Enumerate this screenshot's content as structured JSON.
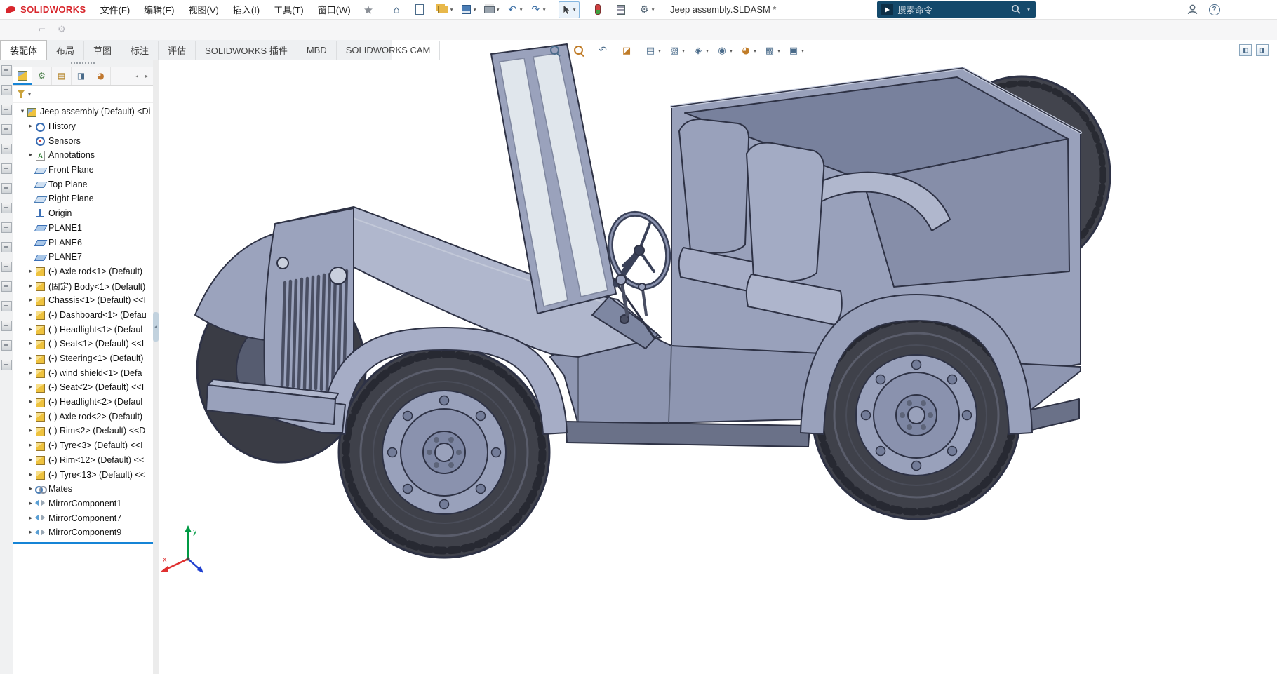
{
  "window": {
    "brand": "SOLIDWORKS",
    "document_title": "Jeep assembly.SLDASM *"
  },
  "menu_bar": {
    "items": [
      {
        "label": "文件(F)"
      },
      {
        "label": "编辑(E)"
      },
      {
        "label": "视图(V)"
      },
      {
        "label": "插入(I)"
      },
      {
        "label": "工具(T)"
      },
      {
        "label": "窗口(W)"
      }
    ]
  },
  "quick_toolbar": {
    "items": [
      {
        "icon": "home-icon",
        "caret": "no-caret"
      },
      {
        "icon": "new-document-icon",
        "caret": "no-caret"
      },
      {
        "icon": "open-icon",
        "caret": "with-caret"
      },
      {
        "icon": "save-icon",
        "caret": "with-caret"
      },
      {
        "icon": "print-icon",
        "caret": "with-caret"
      },
      {
        "icon": "undo-icon",
        "caret": "with-caret"
      },
      {
        "icon": "redo-icon",
        "caret": "with-caret"
      }
    ],
    "right_items": [
      {
        "icon": "rebuild-icon",
        "caret": "no-caret"
      },
      {
        "icon": "task-list-icon",
        "caret": "no-caret"
      },
      {
        "icon": "options-gear-icon",
        "caret": "with-caret"
      }
    ]
  },
  "search": {
    "placeholder": "搜索命令"
  },
  "command_tabs": {
    "items": [
      {
        "label": "装配体",
        "state": "active"
      },
      {
        "label": "布局",
        "state": "idle"
      },
      {
        "label": "草图",
        "state": "idle"
      },
      {
        "label": "标注",
        "state": "idle"
      },
      {
        "label": "评估",
        "state": "idle"
      },
      {
        "label": "SOLIDWORKS 插件",
        "state": "idle"
      },
      {
        "label": "MBD",
        "state": "idle"
      },
      {
        "label": "SOLIDWORKS CAM",
        "state": "idle"
      }
    ]
  },
  "left_toolbar": {
    "items": [
      {
        "name": "left-tool-icon"
      },
      {
        "name": "left-tool-icon"
      },
      {
        "name": "left-tool-icon"
      },
      {
        "name": "left-tool-icon"
      },
      {
        "name": "left-tool-icon"
      },
      {
        "name": "left-tool-icon"
      },
      {
        "name": "left-tool-icon"
      },
      {
        "name": "left-tool-icon"
      },
      {
        "name": "left-tool-icon"
      },
      {
        "name": "left-tool-icon"
      },
      {
        "name": "left-tool-icon"
      },
      {
        "name": "left-tool-icon"
      },
      {
        "name": "left-tool-icon"
      },
      {
        "name": "left-tool-icon"
      },
      {
        "name": "left-tool-icon"
      },
      {
        "name": "left-tool-icon"
      }
    ]
  },
  "tree_panel": {
    "tabs": [
      {
        "icon": "feature-tree-tab-icon",
        "state": "active"
      },
      {
        "icon": "property-manager-tab-icon",
        "state": "idle"
      },
      {
        "icon": "configuration-tab-icon",
        "state": "idle"
      },
      {
        "icon": "dimxpert-tab-icon",
        "state": "idle"
      },
      {
        "icon": "display-manager-tab-icon",
        "state": "idle"
      }
    ],
    "nav": [
      {
        "icon": "tabs-scroll-left-icon"
      },
      {
        "icon": "tabs-scroll-right-icon"
      }
    ],
    "root": {
      "label": "Jeep assembly (Default) <Di",
      "icon": "ic-asm",
      "arrow": "expanded"
    },
    "items": [
      {
        "label": "History",
        "icon": "ic-history",
        "arrow": "expandable"
      },
      {
        "label": "Sensors",
        "icon": "ic-sensors",
        "arrow": "leaf"
      },
      {
        "label": "Annotations",
        "icon": "ic-ann",
        "arrow": "expandable"
      },
      {
        "label": "Front Plane",
        "icon": "ic-plane",
        "arrow": "leaf"
      },
      {
        "label": "Top Plane",
        "icon": "ic-plane",
        "arrow": "leaf"
      },
      {
        "label": "Right Plane",
        "icon": "ic-plane",
        "arrow": "leaf"
      },
      {
        "label": "Origin",
        "icon": "ic-origin",
        "arrow": "leaf"
      },
      {
        "label": "PLANE1",
        "icon": "ic-plane2",
        "arrow": "leaf"
      },
      {
        "label": "PLANE6",
        "icon": "ic-plane2",
        "arrow": "leaf"
      },
      {
        "label": "PLANE7",
        "icon": "ic-plane2",
        "arrow": "leaf"
      },
      {
        "label": "(-) Axle rod<1> (Default)",
        "icon": "ic-part",
        "arrow": "expandable"
      },
      {
        "label": "(固定) Body<1> (Default)",
        "icon": "ic-part",
        "arrow": "expandable"
      },
      {
        "label": "Chassis<1> (Default) <<I",
        "icon": "ic-part",
        "arrow": "expandable"
      },
      {
        "label": "(-) Dashboard<1> (Defau",
        "icon": "ic-part",
        "arrow": "expandable"
      },
      {
        "label": "(-) Headlight<1> (Defaul",
        "icon": "ic-part",
        "arrow": "expandable"
      },
      {
        "label": "(-) Seat<1> (Default) <<I",
        "icon": "ic-part",
        "arrow": "expandable"
      },
      {
        "label": "(-) Steering<1> (Default)",
        "icon": "ic-part",
        "arrow": "expandable"
      },
      {
        "label": "(-) wind shield<1> (Defa",
        "icon": "ic-part",
        "arrow": "expandable"
      },
      {
        "label": "(-) Seat<2> (Default) <<I",
        "icon": "ic-part",
        "arrow": "expandable"
      },
      {
        "label": "(-) Headlight<2> (Defaul",
        "icon": "ic-part",
        "arrow": "expandable"
      },
      {
        "label": "(-) Axle rod<2> (Default)",
        "icon": "ic-part",
        "arrow": "expandable"
      },
      {
        "label": "(-) Rim<2> (Default) <<D",
        "icon": "ic-part",
        "arrow": "expandable"
      },
      {
        "label": "(-) Tyre<3> (Default) <<I",
        "icon": "ic-part",
        "arrow": "expandable"
      },
      {
        "label": "(-) Rim<12> (Default) <<",
        "icon": "ic-part",
        "arrow": "expandable"
      },
      {
        "label": "(-) Tyre<13> (Default) <<",
        "icon": "ic-part",
        "arrow": "expandable"
      },
      {
        "label": "Mates",
        "icon": "ic-mates",
        "arrow": "expandable"
      },
      {
        "label": "MirrorComponent1",
        "icon": "ic-mirror",
        "arrow": "expandable"
      },
      {
        "label": "MirrorComponent7",
        "icon": "ic-mirror",
        "arrow": "expandable"
      },
      {
        "label": "MirrorComponent9",
        "icon": "ic-mirror",
        "arrow": "expandable"
      }
    ]
  },
  "hud": {
    "items": [
      {
        "icon": "zoom-fit-icon",
        "caret": "no-caret"
      },
      {
        "icon": "zoom-area-icon",
        "caret": "no-caret"
      },
      {
        "icon": "previous-view-icon",
        "caret": "no-caret"
      },
      {
        "icon": "section-view-icon",
        "caret": "no-caret"
      },
      {
        "icon": "dynamic-annotation-icon",
        "caret": "with-caret"
      },
      {
        "icon": "view-orientation-icon",
        "caret": "with-caret"
      },
      {
        "icon": "display-style-icon",
        "caret": "with-caret"
      },
      {
        "icon": "hide-show-items-icon",
        "caret": "with-caret"
      },
      {
        "icon": "edit-appearance-icon",
        "caret": "with-caret"
      },
      {
        "icon": "apply-scene-icon",
        "caret": "with-caret"
      },
      {
        "icon": "view-settings-icon",
        "caret": "with-caret"
      }
    ]
  },
  "viewport": {
    "triad": {
      "x_label": "x",
      "y_label": "y"
    }
  },
  "colors": {
    "accent_blue": "#1584d6",
    "search_bar_bg": "#14496b",
    "logo_red": "#d8262c",
    "model_body_gray": "#a3abc4"
  }
}
